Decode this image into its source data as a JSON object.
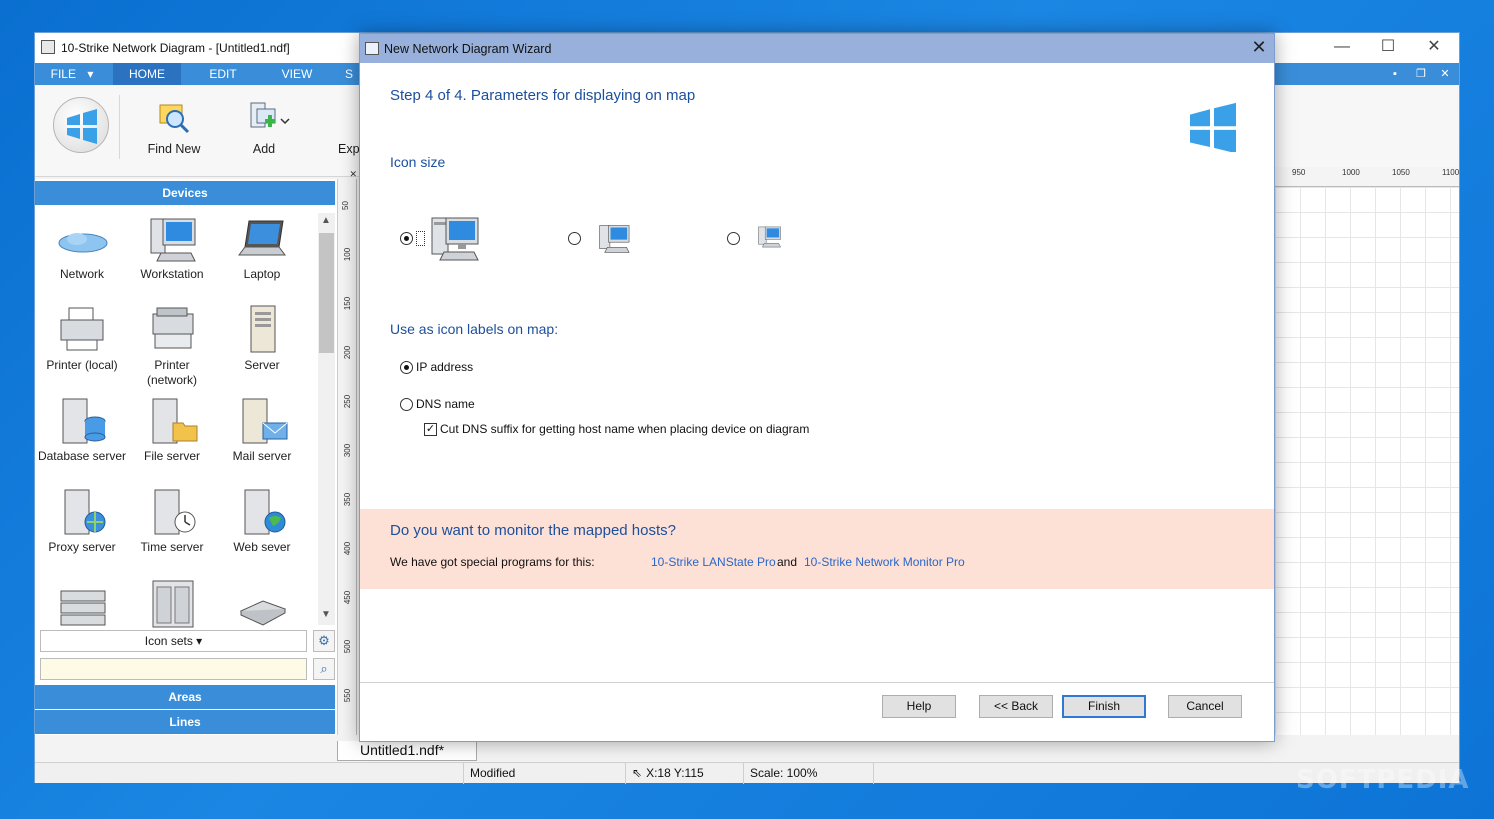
{
  "app": {
    "title": "10-Strike Network Diagram - [Untitled1.ndf]",
    "window_buttons": {
      "minimize": "—",
      "maximize": "☐",
      "close": "✕"
    },
    "tabs": [
      "FILE",
      "HOME",
      "EDIT",
      "VIEW",
      "S"
    ],
    "active_tab": "HOME",
    "file_arrow": "▾",
    "mdi_buttons": {
      "minimize": "▪",
      "restore": "❐",
      "close": "✕"
    }
  },
  "ribbon": {
    "find_new": "Find New",
    "add": "Add",
    "export_partial": "Exp"
  },
  "left_panel": {
    "devices_header": "Devices",
    "devices": [
      {
        "label": "Network",
        "icon": "cloud-icon"
      },
      {
        "label": "Workstation",
        "icon": "workstation-icon"
      },
      {
        "label": "Laptop",
        "icon": "laptop-icon"
      },
      {
        "label": "Printer (local)",
        "icon": "printer-icon"
      },
      {
        "label": "Printer\n(network)",
        "icon": "network-printer-icon"
      },
      {
        "label": "Server",
        "icon": "server-icon"
      },
      {
        "label": "Database server",
        "icon": "database-server-icon"
      },
      {
        "label": "File server",
        "icon": "file-server-icon"
      },
      {
        "label": "Mail server",
        "icon": "mail-server-icon"
      },
      {
        "label": "Proxy server",
        "icon": "proxy-server-icon"
      },
      {
        "label": "Time server",
        "icon": "time-server-icon"
      },
      {
        "label": "Web sever",
        "icon": "web-server-icon"
      },
      {
        "label": "",
        "icon": "switch-icon"
      },
      {
        "label": "",
        "icon": "rack-icon"
      },
      {
        "label": "",
        "icon": "router-icon"
      }
    ],
    "icon_sets": "Icon sets",
    "icon_sets_arrow": "▾",
    "search_placeholder": "",
    "areas_header": "Areas",
    "lines_header": "Lines"
  },
  "rulers": {
    "vertical": [
      "50",
      "100",
      "150",
      "200",
      "250",
      "300",
      "350",
      "400",
      "450",
      "500",
      "550"
    ],
    "horizontal": [
      "950",
      "1000",
      "1050",
      "1100"
    ]
  },
  "document_tab": "Untitled1.ndf*",
  "statusbar": {
    "state": "Modified",
    "coords": "X:18  Y:115",
    "scale": "Scale: 100%"
  },
  "wizard": {
    "title": "New Network Diagram Wizard",
    "close": "✕",
    "step": "Step 4 of 4. Parameters for displaying on map",
    "icon_size_heading": "Icon size",
    "icon_size_selected": "large",
    "labels_heading": "Use as icon labels on map:",
    "label_options": [
      {
        "label": "IP address",
        "checked": true
      },
      {
        "label": "DNS name",
        "checked": false
      }
    ],
    "cut_dns": {
      "label": "Cut DNS suffix for getting host name when placing device on diagram",
      "checked": true,
      "mark": "✓"
    },
    "promo": {
      "title": "Do you want to monitor the mapped hosts?",
      "text": "We have got special programs for this:",
      "link1": "10-Strike LANState Pro",
      "and": "and",
      "link2": "10-Strike Network Monitor Pro"
    },
    "buttons": {
      "help": "Help",
      "back": "<< Back",
      "finish": "Finish",
      "cancel": "Cancel"
    }
  },
  "watermark": "SOFTPEDIA",
  "colors": {
    "accent": "#3a8ed9",
    "wizard_title": "#98b1dc",
    "heading": "#1c4f9c",
    "promo_bg": "#fde1d6",
    "link": "#2a67c7",
    "desktop": "#1b86e3"
  }
}
